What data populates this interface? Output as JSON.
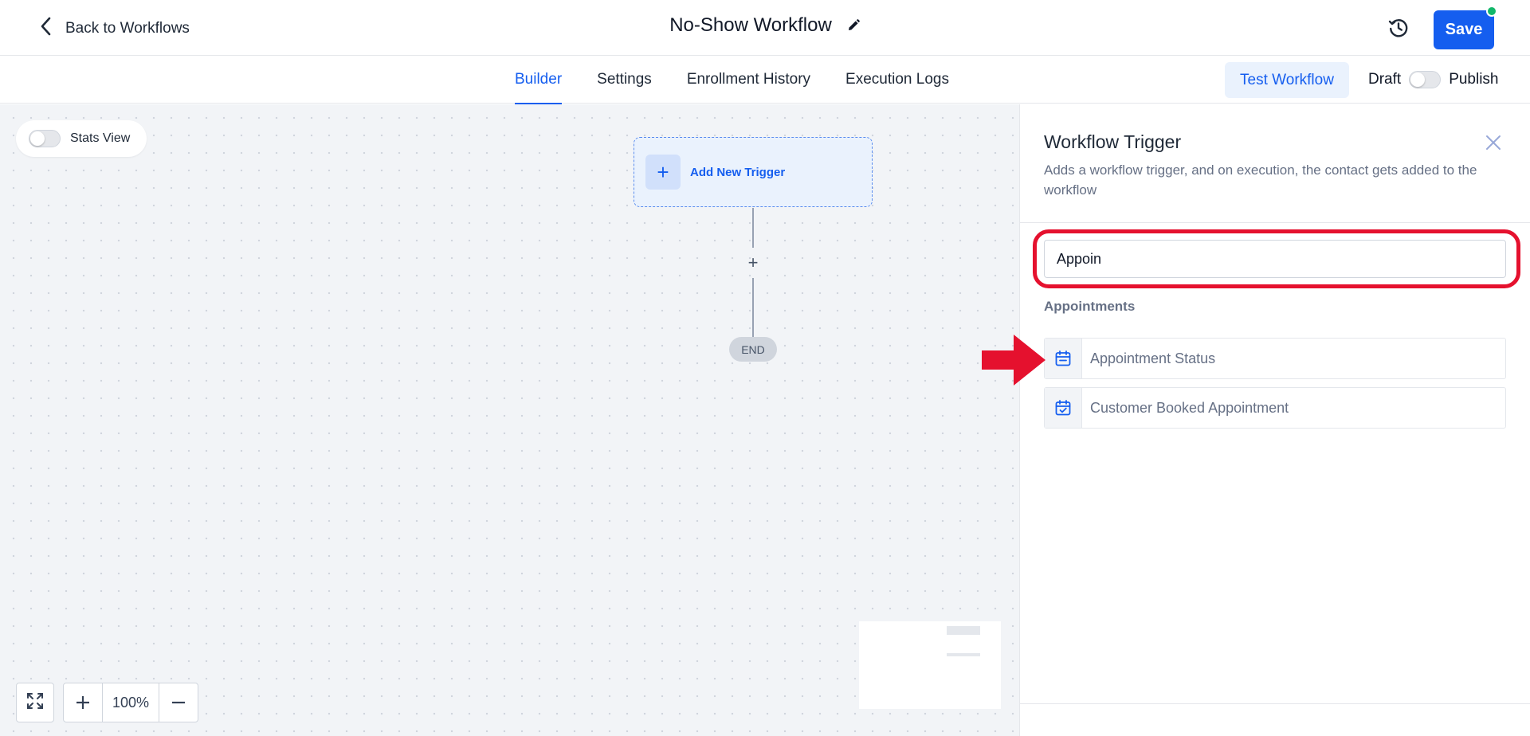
{
  "header": {
    "back_label": "Back to Workflows",
    "title": "No-Show Workflow",
    "save_label": "Save"
  },
  "tabs": [
    {
      "label": "Builder",
      "active": true
    },
    {
      "label": "Settings",
      "active": false
    },
    {
      "label": "Enrollment History",
      "active": false
    },
    {
      "label": "Execution Logs",
      "active": false
    }
  ],
  "actions": {
    "test_workflow_label": "Test Workflow",
    "draft_label": "Draft",
    "publish_label": "Publish"
  },
  "canvas": {
    "stats_view_label": "Stats View",
    "trigger_label": "Add New Trigger",
    "end_label": "END",
    "zoom_level": "100%"
  },
  "panel": {
    "title": "Workflow Trigger",
    "description": "Adds a workflow trigger, and on execution, the contact gets added to the workflow",
    "search_value": "Appoin",
    "group_label": "Appointments",
    "options": [
      {
        "label": "Appointment Status",
        "icon": "calendar-icon"
      },
      {
        "label": "Customer Booked Appointment",
        "icon": "calendar-check-icon"
      }
    ]
  },
  "colors": {
    "accent": "#155eef",
    "annotation_red": "#e5112e",
    "online_dot": "#12b76a"
  }
}
